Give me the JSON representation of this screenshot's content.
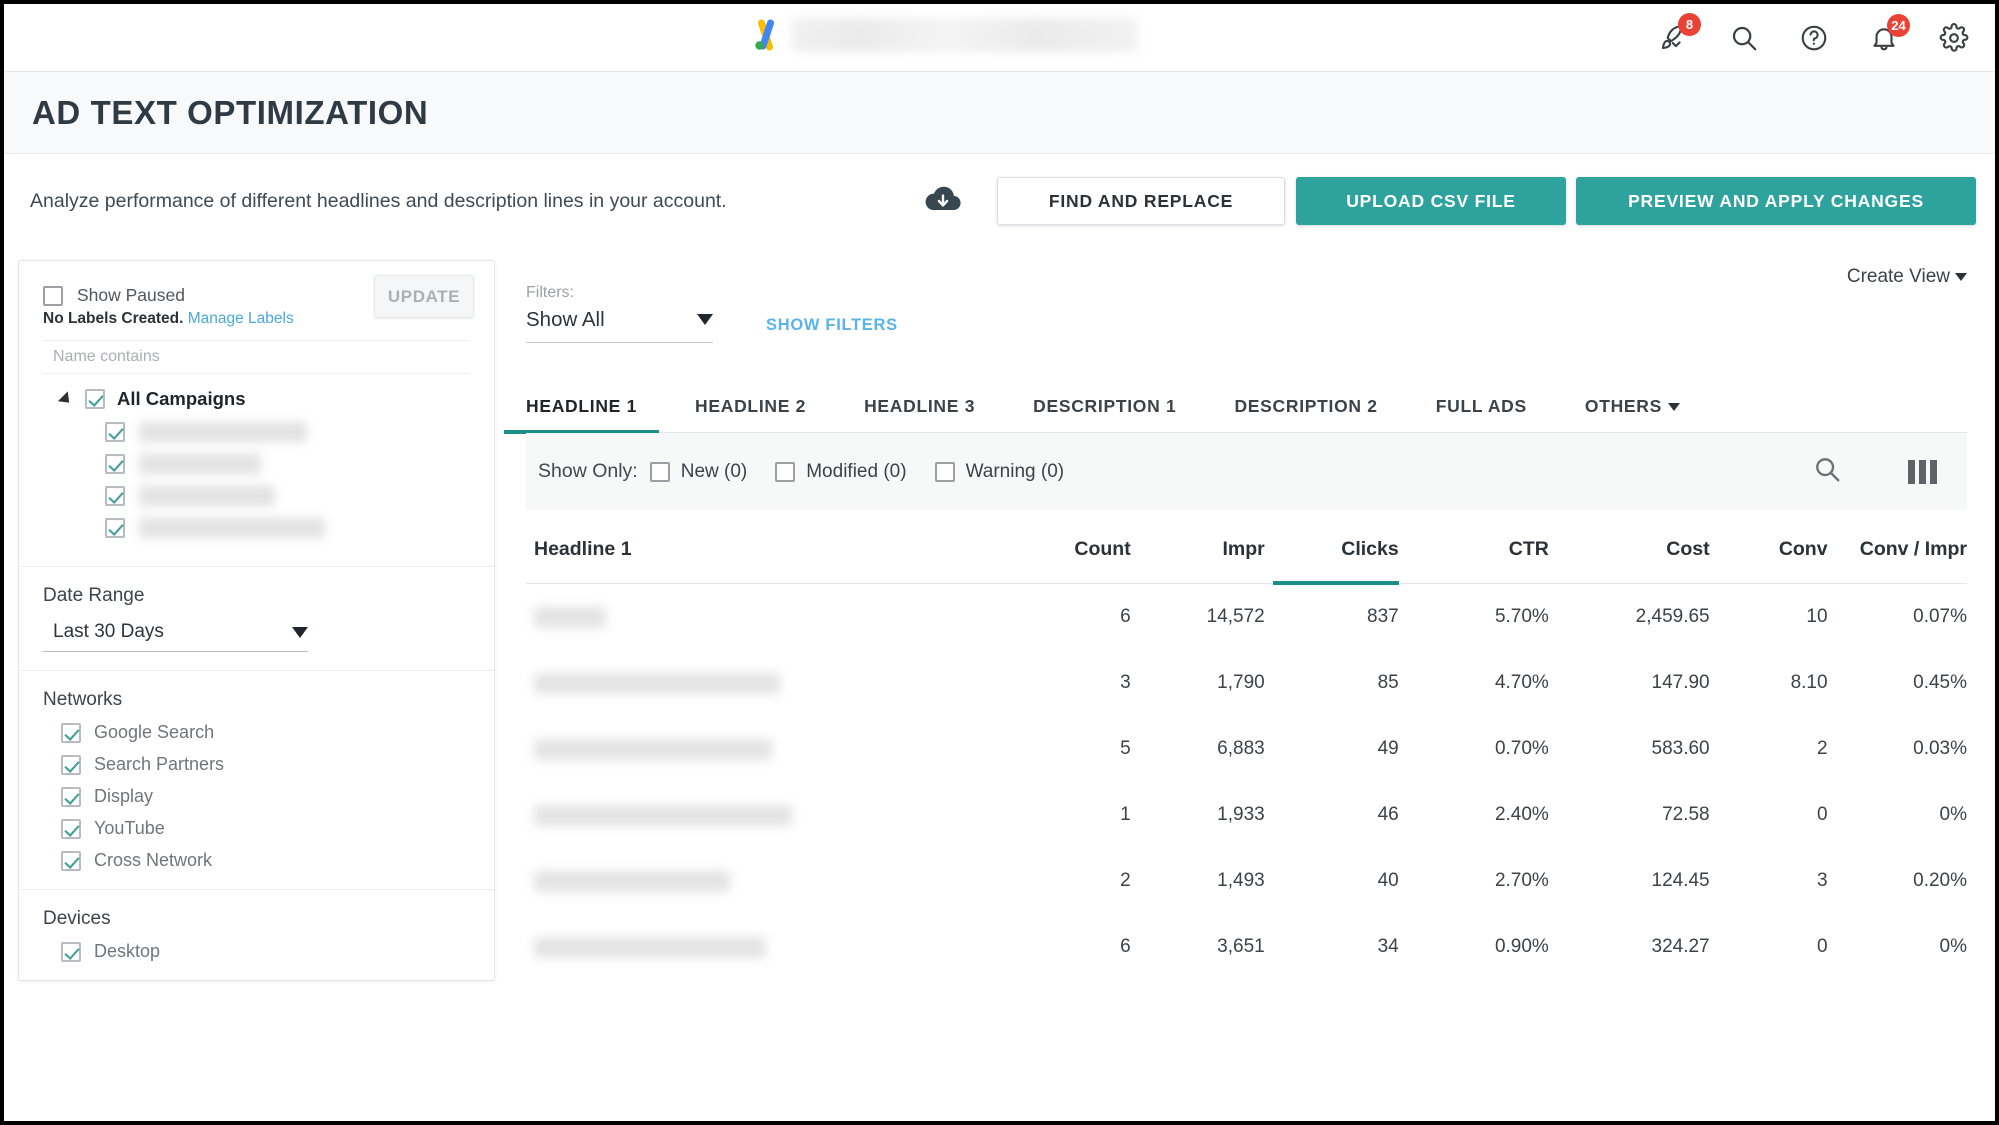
{
  "topbar": {
    "icons": [
      {
        "name": "rocket-icon",
        "badge": "8"
      },
      {
        "name": "search-icon",
        "badge": ""
      },
      {
        "name": "help-icon",
        "badge": ""
      },
      {
        "name": "notifications-bell-icon",
        "badge": "24"
      },
      {
        "name": "settings-gear-icon",
        "badge": ""
      }
    ]
  },
  "page": {
    "title": "AD TEXT OPTIMIZATION",
    "subtitle": "Analyze performance of different headlines and description lines in your account."
  },
  "actions": {
    "download_icon": "cloud-download-icon",
    "find_and_replace": "FIND AND REPLACE",
    "upload_csv": "UPLOAD CSV FILE",
    "preview_apply": "PREVIEW AND APPLY CHANGES"
  },
  "sidebar": {
    "show_paused_label": "Show Paused",
    "show_paused_checked": false,
    "update_button": "UPDATE",
    "labels_text": "No Labels Created.",
    "manage_labels_link": "Manage Labels",
    "name_filter_placeholder": "Name contains",
    "name_filter_value": "",
    "tree_root_label": "All Campaigns",
    "tree_root_checked": true,
    "tree_children_count": 4,
    "date_range": {
      "heading": "Date Range",
      "value": "Last 30 Days"
    },
    "networks": {
      "heading": "Networks",
      "items": [
        {
          "label": "Google Search",
          "checked": true
        },
        {
          "label": "Search Partners",
          "checked": true
        },
        {
          "label": "Display",
          "checked": true
        },
        {
          "label": "YouTube",
          "checked": true
        },
        {
          "label": "Cross Network",
          "checked": true
        }
      ]
    },
    "devices": {
      "heading": "Devices",
      "items": [
        {
          "label": "Desktop",
          "checked": true
        }
      ]
    }
  },
  "main": {
    "create_view": "Create View",
    "filters_label": "Filters:",
    "filter_value": "Show All",
    "show_filters": "SHOW FILTERS",
    "tabs": [
      {
        "label": "HEADLINE 1",
        "active": true
      },
      {
        "label": "HEADLINE 2",
        "active": false
      },
      {
        "label": "HEADLINE 3",
        "active": false
      },
      {
        "label": "DESCRIPTION 1",
        "active": false
      },
      {
        "label": "DESCRIPTION 2",
        "active": false
      },
      {
        "label": "FULL ADS",
        "active": false
      },
      {
        "label": "OTHERS",
        "active": false,
        "dropdown": true
      }
    ],
    "show_only": {
      "label": "Show Only:",
      "options": [
        {
          "label": "New (0)",
          "checked": false
        },
        {
          "label": "Modified (0)",
          "checked": false
        },
        {
          "label": "Warning (0)",
          "checked": false
        }
      ],
      "search_icon": "search-icon",
      "columns_icon": "columns-icon"
    },
    "table": {
      "columns": [
        "Headline 1",
        "Count",
        "Impr",
        "Clicks",
        "CTR",
        "Cost",
        "Conv",
        "Conv / Impr"
      ],
      "sorted_column": "Clicks",
      "rows": [
        {
          "headline": "",
          "headline_blur_width": 72,
          "count": "6",
          "impr": "14,572",
          "clicks": "837",
          "ctr": "5.70%",
          "cost": "2,459.65",
          "conv": "10",
          "conv_impr": "0.07%"
        },
        {
          "headline": "",
          "headline_blur_width": 246,
          "count": "3",
          "impr": "1,790",
          "clicks": "85",
          "ctr": "4.70%",
          "cost": "147.90",
          "conv": "8.10",
          "conv_impr": "0.45%"
        },
        {
          "headline": "",
          "headline_blur_width": 238,
          "count": "5",
          "impr": "6,883",
          "clicks": "49",
          "ctr": "0.70%",
          "cost": "583.60",
          "conv": "2",
          "conv_impr": "0.03%"
        },
        {
          "headline": "",
          "headline_blur_width": 258,
          "count": "1",
          "impr": "1,933",
          "clicks": "46",
          "ctr": "2.40%",
          "cost": "72.58",
          "conv": "0",
          "conv_impr": "0%"
        },
        {
          "headline": "",
          "headline_blur_width": 196,
          "count": "2",
          "impr": "1,493",
          "clicks": "40",
          "ctr": "2.70%",
          "cost": "124.45",
          "conv": "3",
          "conv_impr": "0.20%"
        },
        {
          "headline": "",
          "headline_blur_width": 232,
          "count": "6",
          "impr": "3,651",
          "clicks": "34",
          "ctr": "0.90%",
          "cost": "324.27",
          "conv": "0",
          "conv_impr": "0%"
        }
      ]
    }
  },
  "colors": {
    "accent_teal": "#2ea39e",
    "accent_teal_dark": "#1d8f8a",
    "badge_red": "#ea4335",
    "link_blue": "#5ab4e8",
    "page_header_bg": "#f8f9fb"
  }
}
